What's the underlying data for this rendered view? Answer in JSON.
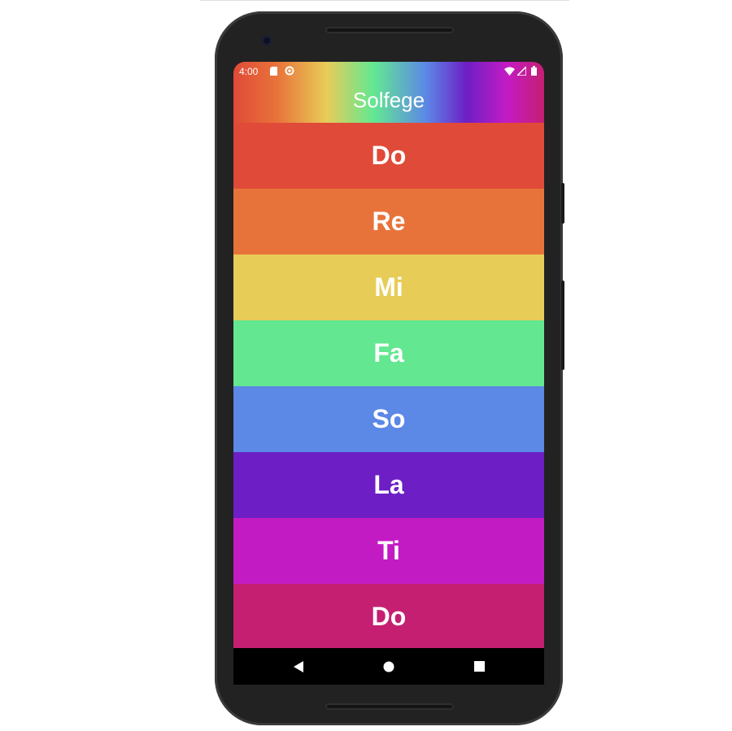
{
  "status_bar": {
    "time": "4:00"
  },
  "app": {
    "title": "Solfege"
  },
  "notes": [
    {
      "label": "Do",
      "color": "#e04a38"
    },
    {
      "label": "Re",
      "color": "#e8733a"
    },
    {
      "label": "Mi",
      "color": "#e8cc58"
    },
    {
      "label": "Fa",
      "color": "#63e891"
    },
    {
      "label": "So",
      "color": "#5c88e6"
    },
    {
      "label": "La",
      "color": "#6d1fc5"
    },
    {
      "label": "Ti",
      "color": "#c31bc4"
    },
    {
      "label": "Do",
      "color": "#c51f72"
    }
  ],
  "nav_bar": {
    "back_icon": "back-triangle-icon",
    "home_icon": "home-circle-icon",
    "recents_icon": "recents-square-icon"
  }
}
